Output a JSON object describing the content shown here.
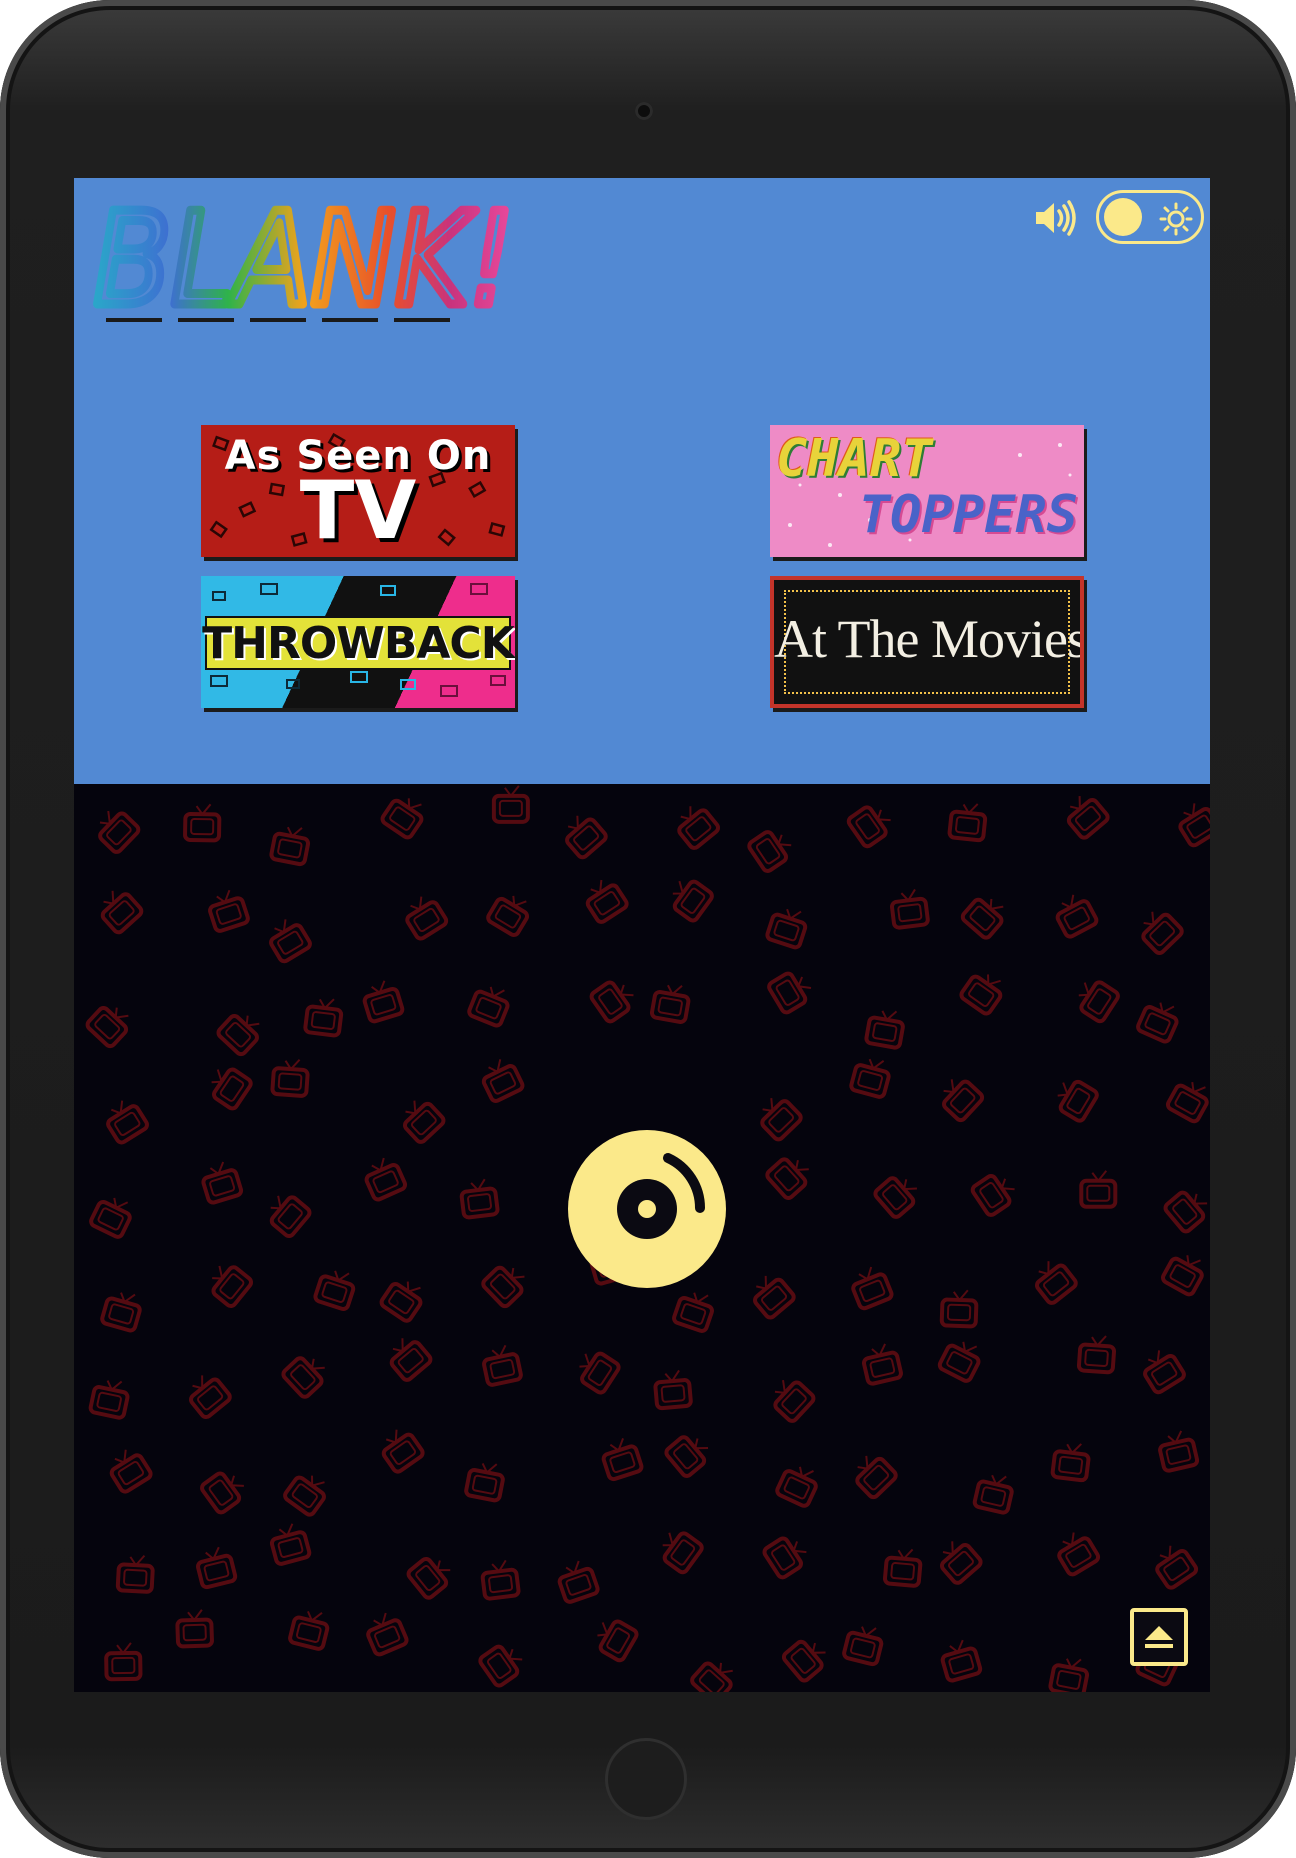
{
  "app": {
    "logo_text": "BLANK!"
  },
  "header": {
    "sound_icon": "speaker-volume-icon",
    "theme_toggle": {
      "state": "on",
      "icon": "sun-icon"
    }
  },
  "categories": [
    {
      "line1": "As Seen On",
      "line2": "TV"
    },
    {
      "line1": "CHART",
      "line2": "TOPPERS"
    },
    {
      "line1": "THROWBACK"
    },
    {
      "line1": "At The Movies"
    }
  ],
  "play": {
    "icon": "vinyl-record-icon"
  },
  "collapse": {
    "icon": "eject-up-icon"
  },
  "colors": {
    "panel_blue": "#5289d3",
    "accent_yellow": "#fbe98a",
    "background_dark": "#05040d",
    "pattern_red": "#5a0c12"
  }
}
